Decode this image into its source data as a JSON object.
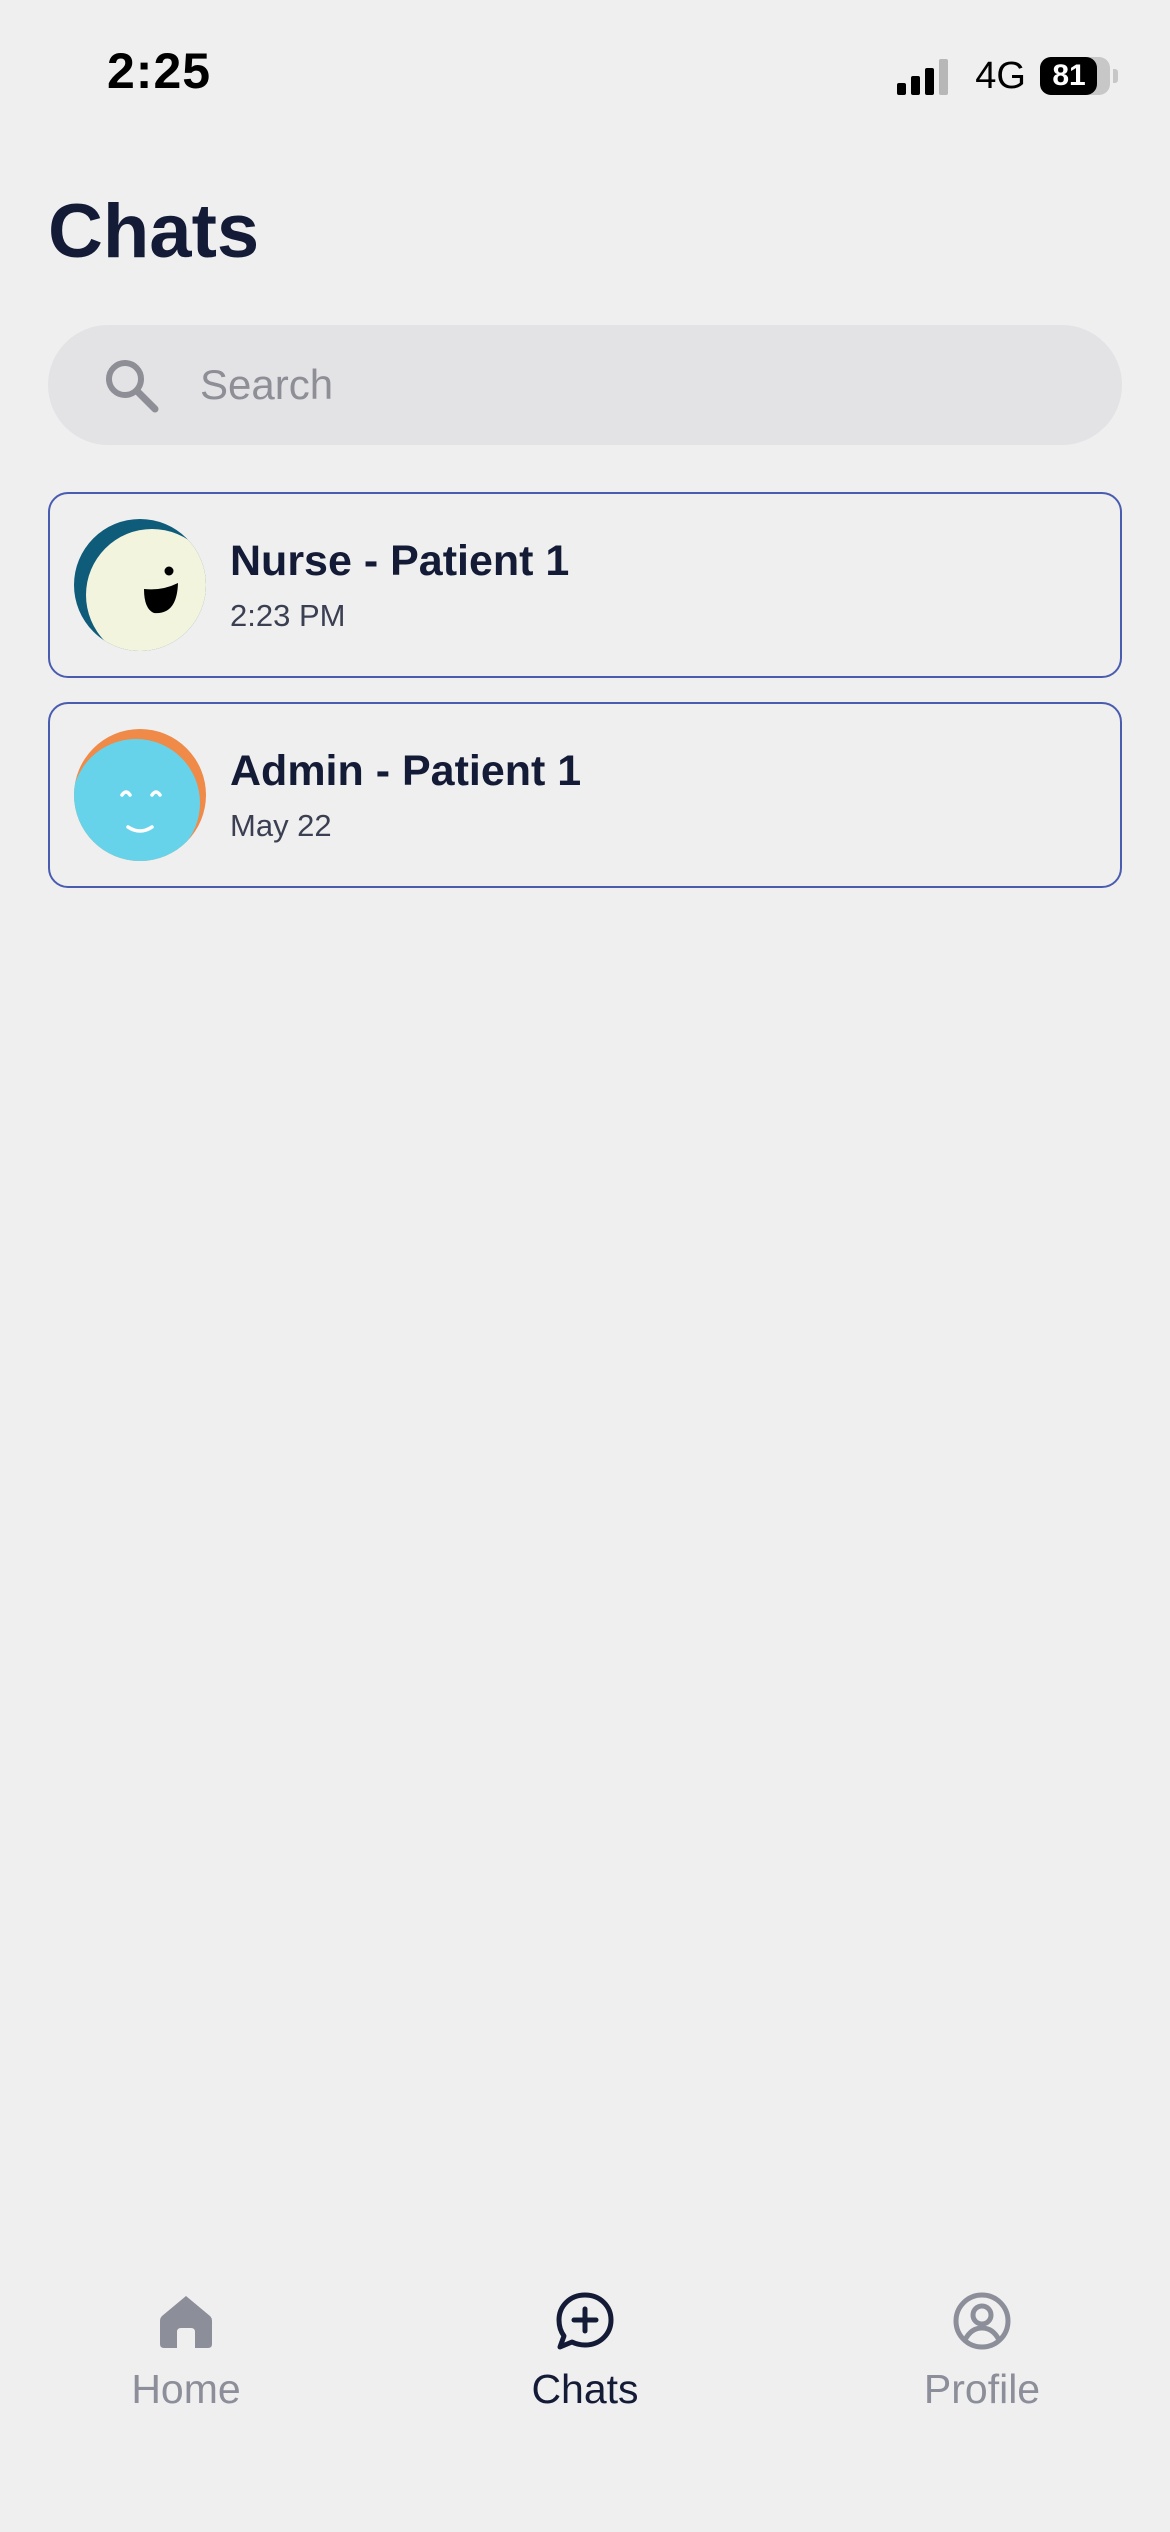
{
  "status_bar": {
    "time": "2:25",
    "network": "4G",
    "battery": "81",
    "battery_level": 0.81,
    "signal_bars": 3
  },
  "header": {
    "title": "Chats"
  },
  "search": {
    "placeholder": "Search",
    "value": ""
  },
  "chats": [
    {
      "name": "Nurse - Patient 1",
      "time": "2:23 PM",
      "avatar_icon": "smiley-avatar-icon",
      "avatar_colors": {
        "back": "#0e5b7a",
        "face": "#f3f4dd",
        "features": "#000000"
      }
    },
    {
      "name": "Admin - Patient 1",
      "time": "May 22",
      "avatar_icon": "smiley-avatar-icon",
      "avatar_colors": {
        "back": "#ef8a48",
        "face": "#67d3ea",
        "features": "#ffffff"
      }
    }
  ],
  "tabs": [
    {
      "label": "Home",
      "icon": "home-icon",
      "active": false
    },
    {
      "label": "Chats",
      "icon": "chat-plus-icon",
      "active": true
    },
    {
      "label": "Profile",
      "icon": "user-circle-icon",
      "active": false
    }
  ],
  "colors": {
    "background": "#efefef",
    "text_primary": "#141b36",
    "text_muted": "#8c8e99",
    "card_border": "#4a5cb0",
    "search_bg": "#e3e3e5"
  }
}
